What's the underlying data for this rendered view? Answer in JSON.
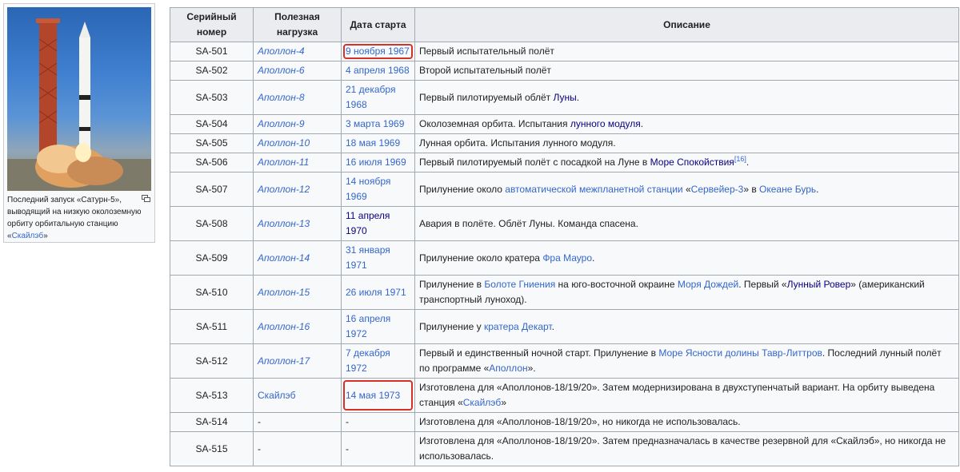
{
  "thumbnail": {
    "caption_pre": "Последний запуск «Сатурн-5», выводящий на низкую околоземную орбиту орбитальную станцию «",
    "caption_link": "Скайлэб",
    "caption_post": "»"
  },
  "table": {
    "headers": {
      "serial_line1": "Серийный",
      "serial_line2": "номер",
      "payload_line1": "Полезная",
      "payload_line2": "нагрузка",
      "date": "Дата старта",
      "description": "Описание"
    },
    "rows": [
      {
        "serial": "SA-501",
        "payload": "Аполлон-4",
        "date": "9 ноября 1967",
        "highlighted": true,
        "desc": [
          {
            "t": "Первый испытательный полёт"
          }
        ]
      },
      {
        "serial": "SA-502",
        "payload": "Аполлон-6",
        "date": "4 апреля 1968",
        "desc": [
          {
            "t": "Второй испытательный полёт"
          }
        ]
      },
      {
        "serial": "SA-503",
        "payload": "Аполлон-8",
        "date": "21 декабря 1968",
        "desc": [
          {
            "t": "Первый пилотируемый облёт "
          },
          {
            "t": "Луны",
            "link": true,
            "visited": true
          },
          {
            "t": "."
          }
        ]
      },
      {
        "serial": "SA-504",
        "payload": "Аполлон-9",
        "date": "3 марта 1969",
        "desc": [
          {
            "t": "Околоземная орбита. Испытания "
          },
          {
            "t": "лунного модуля",
            "link": true,
            "visited": true
          },
          {
            "t": "."
          }
        ]
      },
      {
        "serial": "SA-505",
        "payload": "Аполлон-10",
        "date": "18 мая 1969",
        "desc": [
          {
            "t": "Лунная орбита. Испытания лунного модуля."
          }
        ]
      },
      {
        "serial": "SA-506",
        "payload": "Аполлон-11",
        "date": "16 июля 1969",
        "desc": [
          {
            "t": "Первый пилотируемый полёт с посадкой на Луне в "
          },
          {
            "t": "Море Спокойствия",
            "link": true,
            "visited": true
          },
          {
            "t": "[16]",
            "sup": true,
            "link": true
          },
          {
            "t": "."
          }
        ]
      },
      {
        "serial": "SA-507",
        "payload": "Аполлон-12",
        "date": "14 ноября 1969",
        "desc": [
          {
            "t": "Прилунение около "
          },
          {
            "t": "автоматической межпланетной станции",
            "link": true
          },
          {
            "t": " «"
          },
          {
            "t": "Сервейер-3",
            "link": true
          },
          {
            "t": "» в "
          },
          {
            "t": "Океане Бурь",
            "link": true
          },
          {
            "t": "."
          }
        ]
      },
      {
        "serial": "SA-508",
        "payload": "Аполлон-13",
        "date": "11 апреля 1970",
        "date_visited": true,
        "desc": [
          {
            "t": "Авария в полёте. Облёт Луны. Команда спасена."
          }
        ]
      },
      {
        "serial": "SA-509",
        "payload": "Аполлон-14",
        "date": "31 января 1971",
        "desc": [
          {
            "t": "Прилунение около кратера "
          },
          {
            "t": "Фра Мауро",
            "link": true
          },
          {
            "t": "."
          }
        ]
      },
      {
        "serial": "SA-510",
        "payload": "Аполлон-15",
        "date": "26 июля 1971",
        "desc": [
          {
            "t": "Прилунение в "
          },
          {
            "t": "Болоте Гниения",
            "link": true
          },
          {
            "t": " на юго-восточной окраине "
          },
          {
            "t": "Моря Дождей",
            "link": true
          },
          {
            "t": ". Первый «"
          },
          {
            "t": "Лунный Ровер",
            "link": true,
            "visited": true
          },
          {
            "t": "» (американский транспортный луноход)."
          }
        ]
      },
      {
        "serial": "SA-511",
        "payload": "Аполлон-16",
        "date": "16 апреля 1972",
        "desc": [
          {
            "t": "Прилунение у "
          },
          {
            "t": "кратера Декарт",
            "link": true
          },
          {
            "t": "."
          }
        ]
      },
      {
        "serial": "SA-512",
        "payload": "Аполлон-17",
        "date": "7 декабря 1972",
        "desc": [
          {
            "t": "Первый и единственный ночной старт. Прилунение в "
          },
          {
            "t": "Море Ясности",
            "link": true
          },
          {
            "t": " "
          },
          {
            "t": "долины Тавр-Литтров",
            "link": true
          },
          {
            "t": ". Последний лунный полёт по программе «"
          },
          {
            "t": "Аполлон",
            "link": true
          },
          {
            "t": "»."
          }
        ]
      },
      {
        "serial": "SA-513",
        "payload": "Скайлэб",
        "payload_plain": true,
        "date": "14 мая 1973",
        "highlighted": true,
        "desc": [
          {
            "t": "Изготовлена для «Аполлонов-18/19/20». Затем модернизирована в двухступенчатый вариант. На орбиту выведена станция «"
          },
          {
            "t": "Скайлэб",
            "link": true
          },
          {
            "t": "»"
          }
        ]
      },
      {
        "serial": "SA-514",
        "payload": "-",
        "payload_nolink": true,
        "date": "-",
        "date_nolink": true,
        "desc": [
          {
            "t": "Изготовлена для «Аполлонов-18/19/20», но никогда не использовалась."
          }
        ]
      },
      {
        "serial": "SA-515",
        "payload": "-",
        "payload_nolink": true,
        "date": "-",
        "date_nolink": true,
        "desc": [
          {
            "t": "Изготовлена для «Аполлонов-18/19/20». Затем предназначалась в качестве резервной для «Скайлэб», но никогда не использовалась."
          }
        ]
      }
    ]
  },
  "colors": {
    "link": "#3366cc",
    "visited": "#0b0080",
    "highlight": "#d93025"
  }
}
